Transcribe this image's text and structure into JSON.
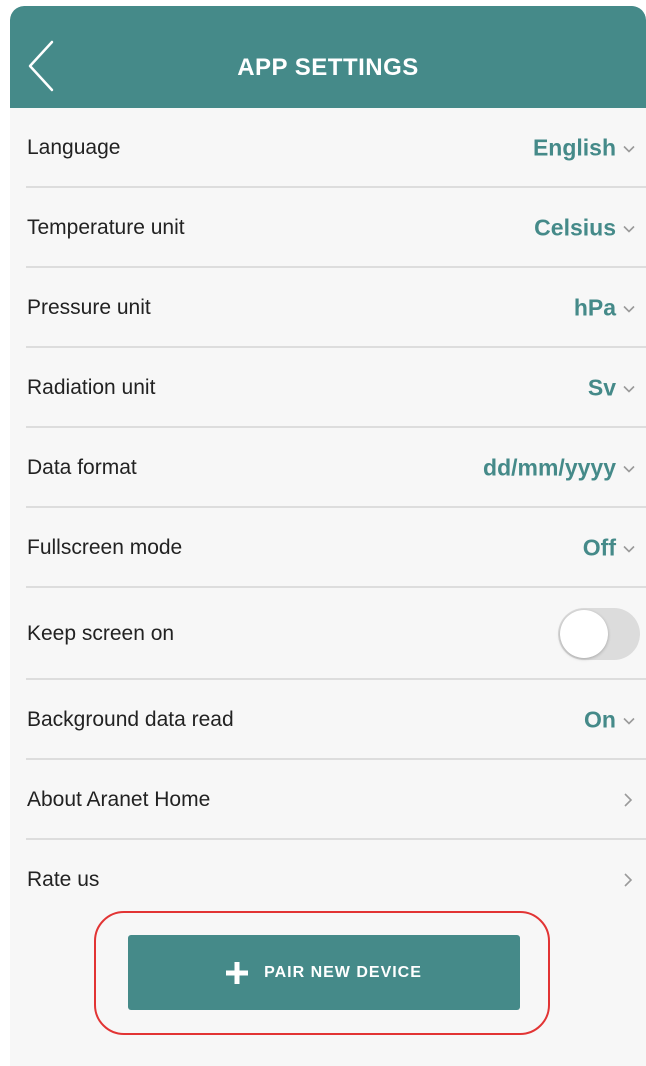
{
  "header": {
    "title": "APP SETTINGS",
    "back_icon": "chevron-left-icon"
  },
  "settings": [
    {
      "label": "Language",
      "value": "English",
      "control": "dropdown"
    },
    {
      "label": "Temperature unit",
      "value": "Celsius",
      "control": "dropdown"
    },
    {
      "label": "Pressure unit",
      "value": "hPa",
      "control": "dropdown"
    },
    {
      "label": "Radiation unit",
      "value": "Sv",
      "control": "dropdown"
    },
    {
      "label": "Data format",
      "value": "dd/mm/yyyy",
      "control": "dropdown"
    },
    {
      "label": "Fullscreen mode",
      "value": "Off",
      "control": "dropdown"
    },
    {
      "label": "Keep screen on",
      "control": "toggle",
      "toggle_state": "off"
    },
    {
      "label": "Background data read",
      "value": "On",
      "control": "dropdown"
    },
    {
      "label": "About Aranet Home",
      "control": "link"
    },
    {
      "label": "Rate us",
      "control": "link"
    }
  ],
  "pair_button": {
    "label": "PAIR NEW DEVICE",
    "icon": "plus-icon"
  },
  "colors": {
    "accent": "#458a89",
    "highlight": "#e23434",
    "background": "#f7f7f7",
    "divider": "#dddddd"
  }
}
